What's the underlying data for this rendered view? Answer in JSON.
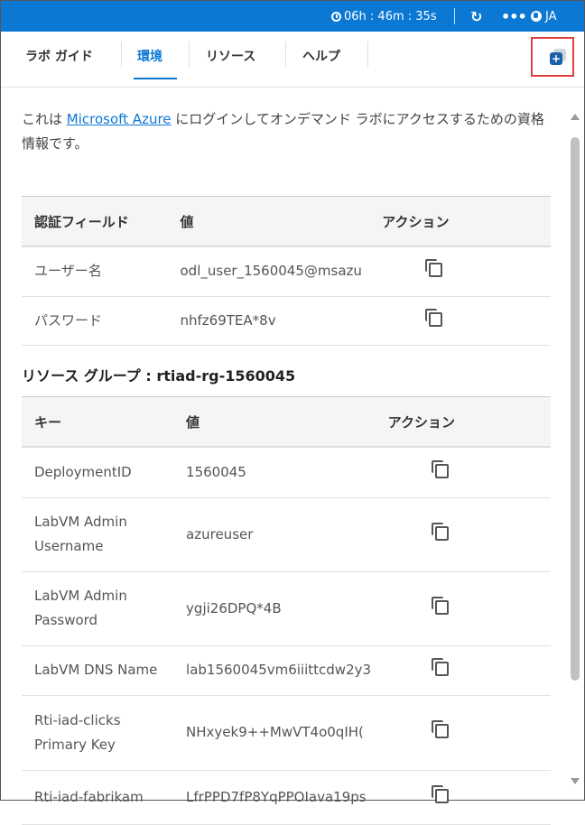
{
  "topbar": {
    "timer": "06h : 46m : 35s",
    "refresh_icon": "refresh-icon",
    "more_label": "•••",
    "language": "JA"
  },
  "tabs": [
    {
      "label": "ラボ ガイド"
    },
    {
      "label": "環境"
    },
    {
      "label": "リソース"
    },
    {
      "label": "ヘルプ"
    }
  ],
  "popout_icon": "popout-icon",
  "intro": {
    "before": "これは ",
    "link": "Microsoft Azure",
    "after": " にログインしてオンデマンド ラボにアクセスするための資格情報です。"
  },
  "credentials": {
    "headers": [
      "認証フィールド",
      "値",
      "アクション"
    ],
    "rows": [
      {
        "field": "ユーザー名",
        "value": "odl_user_1560045@msazu"
      },
      {
        "field": "パスワード",
        "value": "nhfz69TEA*8v"
      }
    ]
  },
  "resource_group": {
    "title": "リソース グループ : rtiad-rg-1560045",
    "headers": [
      "キー",
      "値",
      "アクション"
    ],
    "rows": [
      {
        "key": "DeploymentID",
        "value": "1560045"
      },
      {
        "key": "LabVM Admin Username",
        "value": "azureuser"
      },
      {
        "key": "LabVM Admin Password",
        "value": "ygji26DPQ*4B"
      },
      {
        "key": "LabVM DNS Name",
        "value": "lab1560045vm6iiittcdw2y3"
      },
      {
        "key": "Rti-iad-clicks Primary Key",
        "value": "NHxyek9++MwVT4o0qIH("
      },
      {
        "key": "Rti-iad-fabrikam",
        "value": "LfrPPD7fP8YqPPOIava19ps"
      }
    ]
  }
}
